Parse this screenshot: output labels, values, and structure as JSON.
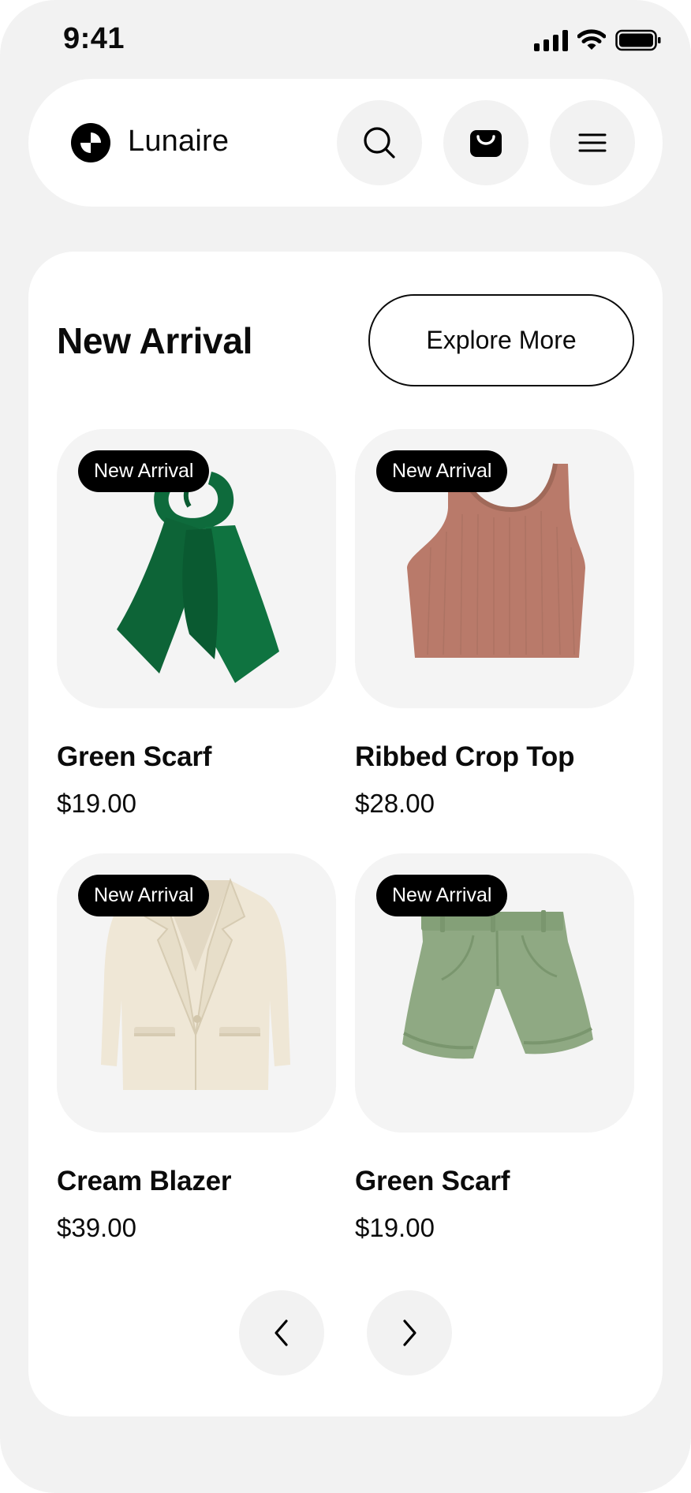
{
  "status_bar": {
    "time": "9:41"
  },
  "header": {
    "brand": "Lunaire",
    "icons": [
      "logo-icon",
      "search-icon",
      "shopping-bag-icon",
      "menu-icon"
    ]
  },
  "section": {
    "title": "New Arrival",
    "explore_label": "Explore More"
  },
  "products": [
    {
      "name": "Green Scarf",
      "price": "$19.00",
      "badge": "New Arrival",
      "image": "green-scarf-image"
    },
    {
      "name": "Ribbed Crop Top",
      "price": "$28.00",
      "badge": "New Arrival",
      "image": "ribbed-crop-top-image"
    },
    {
      "name": "Cream Blazer",
      "price": "$39.00",
      "badge": "New Arrival",
      "image": "cream-blazer-image"
    },
    {
      "name": "Green Scarf",
      "price": "$19.00",
      "badge": "New Arrival",
      "image": "green-shorts-image"
    }
  ],
  "pagination": {
    "icons": [
      "chevron-left-icon",
      "chevron-right-icon"
    ]
  },
  "colors": {
    "background": "#f2f2f2",
    "surface": "#ffffff",
    "text": "#0b0b0b",
    "badge": "#000000",
    "scarf": "#0e6b3c",
    "crop_top": "#b97a6a",
    "blazer": "#efe7d6",
    "shorts": "#8fa983"
  }
}
